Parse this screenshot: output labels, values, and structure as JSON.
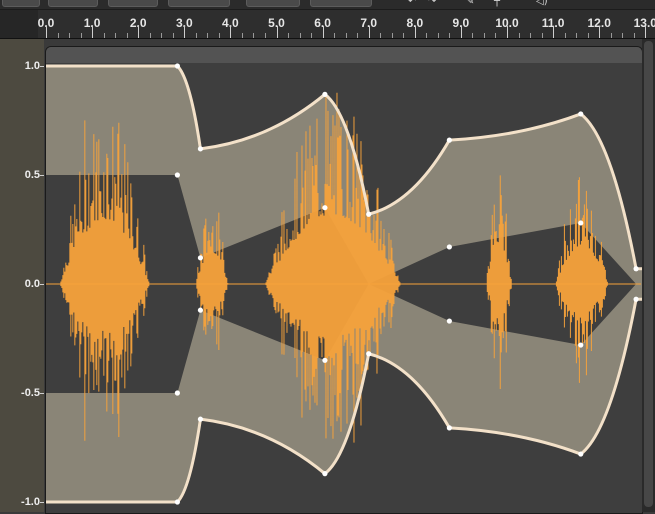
{
  "timeline": {
    "ticks": [
      "0.0",
      "1.0",
      "2.0",
      "3.0",
      "4.0",
      "5.0",
      "6.0",
      "7.0",
      "8.0",
      "9.0",
      "10.0",
      "11.0",
      "12.0",
      "13.0"
    ],
    "tick_values": [
      0,
      1,
      2,
      3,
      4,
      5,
      6,
      7,
      8,
      9,
      10,
      11,
      12,
      13
    ]
  },
  "amplitude_scale": {
    "labels": [
      "1.0",
      "0.5",
      "0.0",
      "-0.5",
      "-1.0"
    ],
    "values": [
      1.0,
      0.5,
      0.0,
      -0.5,
      -1.0
    ]
  },
  "envelope": {
    "time_unit": "seconds",
    "control_points": [
      {
        "t": 0.0,
        "gain": 1.0
      },
      {
        "t": 2.85,
        "gain": 1.0
      },
      {
        "t": 3.35,
        "gain": 0.62
      },
      {
        "t": 6.05,
        "gain": 0.87
      },
      {
        "t": 7.0,
        "gain": 0.32
      },
      {
        "t": 8.75,
        "gain": 0.66
      },
      {
        "t": 11.6,
        "gain": 0.78
      },
      {
        "t": 12.8,
        "gain": 0.07
      },
      {
        "t": 13.0,
        "gain": 0.07
      }
    ],
    "inner_points": [
      {
        "t": 0.0,
        "gain": 0.5
      },
      {
        "t": 2.85,
        "gain": 0.5
      },
      {
        "t": 3.35,
        "gain": 0.12
      },
      {
        "t": 6.05,
        "gain": 0.35
      },
      {
        "t": 7.0,
        "gain": 0.0
      },
      {
        "t": 8.75,
        "gain": 0.17
      },
      {
        "t": 11.6,
        "gain": 0.28
      },
      {
        "t": 12.8,
        "gain": 0.0
      }
    ]
  },
  "waveform": {
    "bursts": [
      {
        "t0": 0.3,
        "t1": 2.25,
        "amp": 0.85
      },
      {
        "t0": 3.25,
        "t1": 3.95,
        "amp": 0.42
      },
      {
        "t0": 4.75,
        "t1": 7.7,
        "amp": 0.9
      },
      {
        "t0": 9.55,
        "t1": 10.1,
        "amp": 0.55
      },
      {
        "t0": 11.05,
        "t1": 12.2,
        "amp": 0.5
      }
    ]
  },
  "colors": {
    "waveform": "#f7a23b",
    "envelope_fill": "#8a8577",
    "envelope_line": "#f3e1c9",
    "clip_bg": "#3e3e3e",
    "point": "#ffffff"
  }
}
